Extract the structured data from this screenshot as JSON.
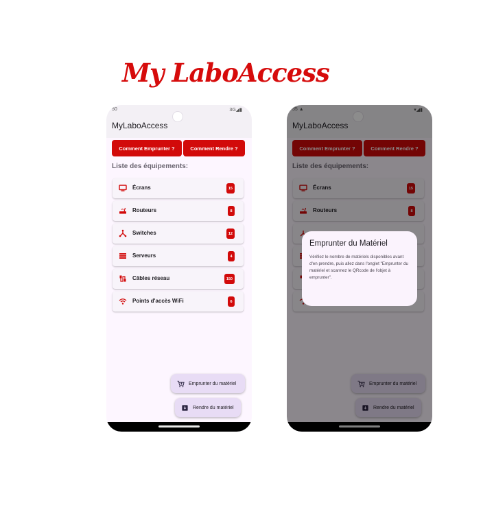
{
  "brand_title": "My LaboAccess",
  "screens": [
    {
      "status_time": "50",
      "status_right": "3G◢▮",
      "app_title": "MyLaboAccess",
      "how_borrow": "Comment Emprunter ?",
      "how_return": "Comment Rendre ?",
      "list_title": "Liste des équipements:",
      "items": [
        {
          "label": "Écrans",
          "count": "15",
          "icon": "monitor-icon"
        },
        {
          "label": "Routeurs",
          "count": "8",
          "icon": "router-icon"
        },
        {
          "label": "Switches",
          "count": "12",
          "icon": "switch-icon"
        },
        {
          "label": "Serveurs",
          "count": "4",
          "icon": "server-icon"
        },
        {
          "label": "Câbles réseau",
          "count": "150",
          "icon": "cable-icon"
        },
        {
          "label": "Points d'accès WiFi",
          "count": "6",
          "icon": "wifi-icon"
        }
      ],
      "fab_borrow": "Emprunter du matériel",
      "fab_return": "Rendre du matériel"
    },
    {
      "status_time": "35 ▲",
      "status_right": "▾◢▮",
      "app_title": "MyLaboAccess",
      "how_borrow": "Comment Emprunter ?",
      "how_return": "Comment Rendre ?",
      "list_title": "Liste des équipements:",
      "items": [
        {
          "label": "Écrans",
          "count": "15",
          "icon": "monitor-icon"
        },
        {
          "label": "Routeurs",
          "count": "8",
          "icon": "router-icon"
        },
        {
          "label": "",
          "count": "",
          "icon": "switch-icon"
        },
        {
          "label": "",
          "count": "",
          "icon": "server-icon"
        },
        {
          "label": "",
          "count": "",
          "icon": "cable-icon"
        },
        {
          "label": "",
          "count": "",
          "icon": "wifi-icon"
        }
      ],
      "fab_borrow": "Emprunter du matériel",
      "fab_return": "Rendre du matériel",
      "dialog": {
        "title": "Emprunter du Matériel",
        "text": "Vérifiez le nombre de matériels disponibles avant d'en prendre, puis allez dans l'onglet \"Emprunter du matériel et scannez le QRcode de l'objet à emprunter\"."
      }
    }
  ],
  "colors": {
    "accent": "#d20a0a",
    "fab_bg": "#e8dcf5",
    "screen_bg": "#fdf6ff"
  }
}
